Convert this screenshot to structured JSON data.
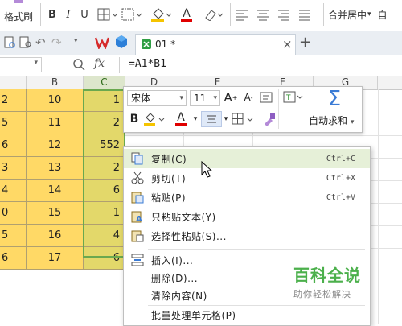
{
  "ribbon": {
    "format_painter_label": "格式刷",
    "bold": "B",
    "italic": "I",
    "underline": "U",
    "font_color_letter": "A",
    "merge_center_label": "合并居中",
    "merge_center_arrow": "▾",
    "autowrap_partial": "自"
  },
  "tabbar": {
    "doc_tab_label": "01 *",
    "close_glyph": "×",
    "new_tab_glyph": "+"
  },
  "formula_bar": {
    "fx_label": "fx",
    "formula": "=A1*B1"
  },
  "sheet": {
    "col_headers": [
      "B",
      "C",
      "D",
      "E",
      "F",
      "G"
    ],
    "col_a_values": [
      "2",
      "5",
      "6",
      "3",
      "4",
      "0",
      "5",
      "6"
    ],
    "col_b_values": [
      "10",
      "11",
      "12",
      "13",
      "14",
      "15",
      "16",
      "17"
    ],
    "col_c_values": [
      "1",
      "2",
      "552",
      "2",
      "6",
      "1",
      "4",
      "6"
    ],
    "accent_yellow": "#ffd966",
    "accent_selection": "#6aa84f"
  },
  "mini_toolbar": {
    "font_name": "宋体",
    "font_size": "11",
    "bold": "B",
    "font_color_letter": "A",
    "autosum_label": "自动求和",
    "sigma": "Σ"
  },
  "context_menu": {
    "items": [
      {
        "label": "复制(C)",
        "shortcut": "Ctrl+C",
        "icon": "copy-icon"
      },
      {
        "label": "剪切(T)",
        "shortcut": "Ctrl+X",
        "icon": "scissors-icon"
      },
      {
        "label": "粘贴(P)",
        "shortcut": "Ctrl+V",
        "icon": "paste-icon"
      },
      {
        "label": "只粘贴文本(Y)",
        "shortcut": "",
        "icon": "paste-text-icon"
      },
      {
        "label": "选择性粘贴(S)...",
        "shortcut": "",
        "icon": "paste-special-icon"
      },
      {
        "label": "插入(I)...",
        "shortcut": "",
        "icon": "insert-icon"
      },
      {
        "label": "删除(D)...",
        "shortcut": "",
        "icon": ""
      },
      {
        "label": "清除内容(N)",
        "shortcut": "",
        "icon": ""
      },
      {
        "label": "批量处理单元格(P)",
        "shortcut": "",
        "icon": ""
      }
    ],
    "highlight_color": "#e6f0d8"
  },
  "watermark": {
    "title": "百科全说",
    "subtitle": "助你轻松解决"
  }
}
